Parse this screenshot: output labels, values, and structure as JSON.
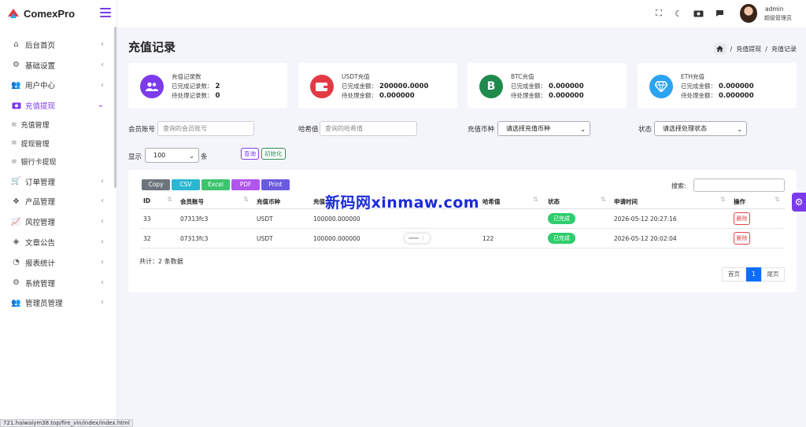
{
  "brand": {
    "name": "ComexPro",
    "accent": "#7c3aed"
  },
  "sidebar": {
    "items": [
      {
        "label": "后台首页",
        "icon": "home-icon"
      },
      {
        "label": "基础设置",
        "icon": "cogs-icon"
      },
      {
        "label": "用户中心",
        "icon": "users-icon"
      },
      {
        "label": "充值提现",
        "icon": "money-icon",
        "active": true
      },
      {
        "label": "订单管理",
        "icon": "cart-icon"
      },
      {
        "label": "产品管理",
        "icon": "cubes-icon"
      },
      {
        "label": "风控管理",
        "icon": "chart-line-icon"
      },
      {
        "label": "文章公告",
        "icon": "layers-icon"
      },
      {
        "label": "报表统计",
        "icon": "pie-chart-icon"
      },
      {
        "label": "系统管理",
        "icon": "gear-icon"
      },
      {
        "label": "管理员管理",
        "icon": "user-group-icon"
      }
    ],
    "subitems": [
      "充值管理",
      "提现管理",
      "银行卡提现"
    ]
  },
  "topbar": {
    "username": "admin",
    "role": "超级管理员"
  },
  "page": {
    "title": "充值记录",
    "breadcrumb": [
      "充值提现",
      "充值记录"
    ]
  },
  "cards": [
    {
      "title": "充值记录数",
      "l1": "已完成记录数：",
      "v1": "2",
      "l2": "待处理记录数：",
      "v2": "0",
      "color": "#7c3aed"
    },
    {
      "title": "USDT充值",
      "l1": "已完成金额：",
      "v1": "200000.0000",
      "l2": "待处理金额：",
      "v2": "0.000000",
      "color": "#e23b45"
    },
    {
      "title": "BTC充值",
      "l1": "已完成金额：",
      "v1": "0.000000",
      "l2": "待处理金额：",
      "v2": "0.000000",
      "color": "#1f8a4c"
    },
    {
      "title": "ETH充值",
      "l1": "已完成金额：",
      "v1": "0.000000",
      "l2": "待处理金额：",
      "v2": "0.000000",
      "color": "#2aa3f0"
    }
  ],
  "filters": {
    "member_label": "会员账号",
    "member_placeholder": "查询的会员账号",
    "hash_label": "哈希值",
    "hash_placeholder": "查询的哈希值",
    "coin_label": "充值币种",
    "coin_select": "请选择充值币种",
    "status_label": "状态",
    "status_select": "请选择处理状态",
    "show_label": "显示",
    "show_value": "100",
    "show_unit": "条",
    "query_btn": "查询",
    "reset_btn": "初始化"
  },
  "export_buttons": [
    "Copy",
    "CSV",
    "Excel",
    "PDF",
    "Print"
  ],
  "table": {
    "search_label": "搜索:",
    "headers": [
      "ID",
      "会员账号",
      "充值币种",
      "充值",
      "哈希值",
      "状态",
      "申请时间",
      "操作"
    ],
    "rows": [
      {
        "id": "33",
        "account": "07313fc3",
        "coin": "USDT",
        "amount": "100000.000000",
        "hash": "",
        "status": "已完成",
        "time": "2026-05-12 20:27:16",
        "action": "删除"
      },
      {
        "id": "32",
        "account": "07313fc3",
        "coin": "USDT",
        "amount": "100000.000000",
        "hash": "122",
        "status": "已完成",
        "time": "2026-05-12 20:02:04",
        "action": "删除"
      }
    ],
    "total": "共计：2 条数据"
  },
  "pagination": {
    "first": "首页",
    "current": "1",
    "last": "尾页"
  },
  "watermark": "新码网xinmaw.com",
  "statusbar_url": "721.haiwaiym38.top/fire_vin/index/index.html"
}
